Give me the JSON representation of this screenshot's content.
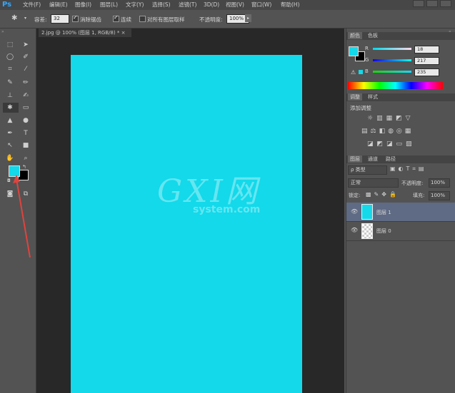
{
  "app": {
    "logo": "Ps"
  },
  "menu": [
    "文件(F)",
    "编辑(E)",
    "图像(I)",
    "图层(L)",
    "文字(Y)",
    "选择(S)",
    "滤镜(T)",
    "3D(D)",
    "视图(V)",
    "窗口(W)",
    "帮助(H)"
  ],
  "options": {
    "tolerance_label": "容差:",
    "tolerance_value": "32",
    "antialias_label": "消除锯齿",
    "contiguous_label": "连续",
    "all_layers_label": "对所有图层取样",
    "opacity_label": "不透明度:",
    "opacity_value": "100%"
  },
  "document": {
    "tab_title": "2.jpg @ 100% (图层 1, RGB/8) * ×",
    "canvas_color": "#13d9ea"
  },
  "color_panel": {
    "tabs": [
      "颜色",
      "色板"
    ],
    "r_label": "R",
    "r_value": "18",
    "g_label": "G",
    "g_value": "217",
    "b_label": "B",
    "b_value": "235"
  },
  "adjust_panel": {
    "tabs": [
      "调整",
      "样式"
    ],
    "title": "添加调整"
  },
  "layers_panel": {
    "tabs": [
      "图层",
      "通道",
      "路径"
    ],
    "filter_label": "ρ 类型",
    "blend_mode": "正常",
    "opacity_label": "不透明度:",
    "opacity_value": "100%",
    "lock_label": "锁定:",
    "fill_label": "填充:",
    "fill_value": "100%",
    "layers": [
      {
        "name": "图层 1",
        "selected": true
      },
      {
        "name": "图层 0",
        "selected": false
      }
    ]
  },
  "colors": {
    "foreground": "#13d9ea",
    "background": "#000000"
  },
  "watermark": {
    "text_big": "GXI网",
    "text_small": "system.com"
  }
}
